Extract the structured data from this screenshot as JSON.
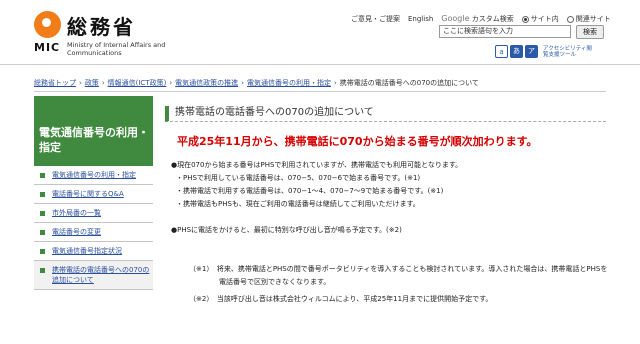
{
  "header": {
    "logo_jp": "総務省",
    "logo_mic": "MIC",
    "logo_en": "Ministry of Internal Affairs and Communications",
    "links": {
      "feedback": "ご意見・ご提案",
      "english": "English"
    },
    "search": {
      "google_label": "Google",
      "custom_label": "カスタム検索",
      "scope_site": "サイト内",
      "scope_web": "関連サイト",
      "placeholder": "ここに検索語句を入力",
      "button": "検索"
    },
    "accessibility": {
      "label": "アクセシビリティ閲覧支援ツール",
      "icons": [
        "a",
        "あ",
        "ア"
      ]
    }
  },
  "breadcrumb": [
    "総務省トップ",
    "政策",
    "情報通信(ICT政策)",
    "電気通信政策の推進",
    "電気通信番号の利用・指定",
    "携帯電話の電話番号への070の追加について"
  ],
  "sidebar": {
    "title": "電気通信番号の利用・指定",
    "items": [
      "電気通信番号の利用・指定",
      "電話番号に関するQ&A",
      "市外局番の一覧",
      "電話番号の変更",
      "電気通信番号指定状況",
      "携帯電話の電話番号への070の追加について"
    ]
  },
  "main": {
    "title": "携帯電話の電話番号への070の追加について",
    "headline": "平成25年11月から、携帯電話に070から始まる番号が順次加わります。",
    "lines": [
      "●現在070から始まる番号はPHSで利用されていますが、携帯電話でも利用可能となります。",
      "PHSで利用している電話番号は、070−5、070−6で始まる番号です。(※1)",
      "携帯電話で利用する電話番号は、070−1〜4、070−7〜9で始まる番号です。(※1)",
      "携帯電話もPHSも、現在ご利用の電話番号は継続してご利用いただけます。",
      "●PHSに電話をかけると、最初に特別な呼び出し音が鳴る予定です。(※2)"
    ],
    "notes": [
      "（※1）　将来、携帯電話とPHSの間で番号ポータビリティを導入することも検討されています。導入された場合は、携帯電話とPHSを電話番号で区別できなくなります。",
      "（※2）　当該呼び出し音は株式会社ウィルコムにより、平成25年11月までに提供開始予定です。"
    ]
  },
  "colors": {
    "brand_green": "#3f8a3f",
    "link": "#2a4fa0",
    "headline_red": "#d40000",
    "logo_orange": "#f07d1a"
  }
}
